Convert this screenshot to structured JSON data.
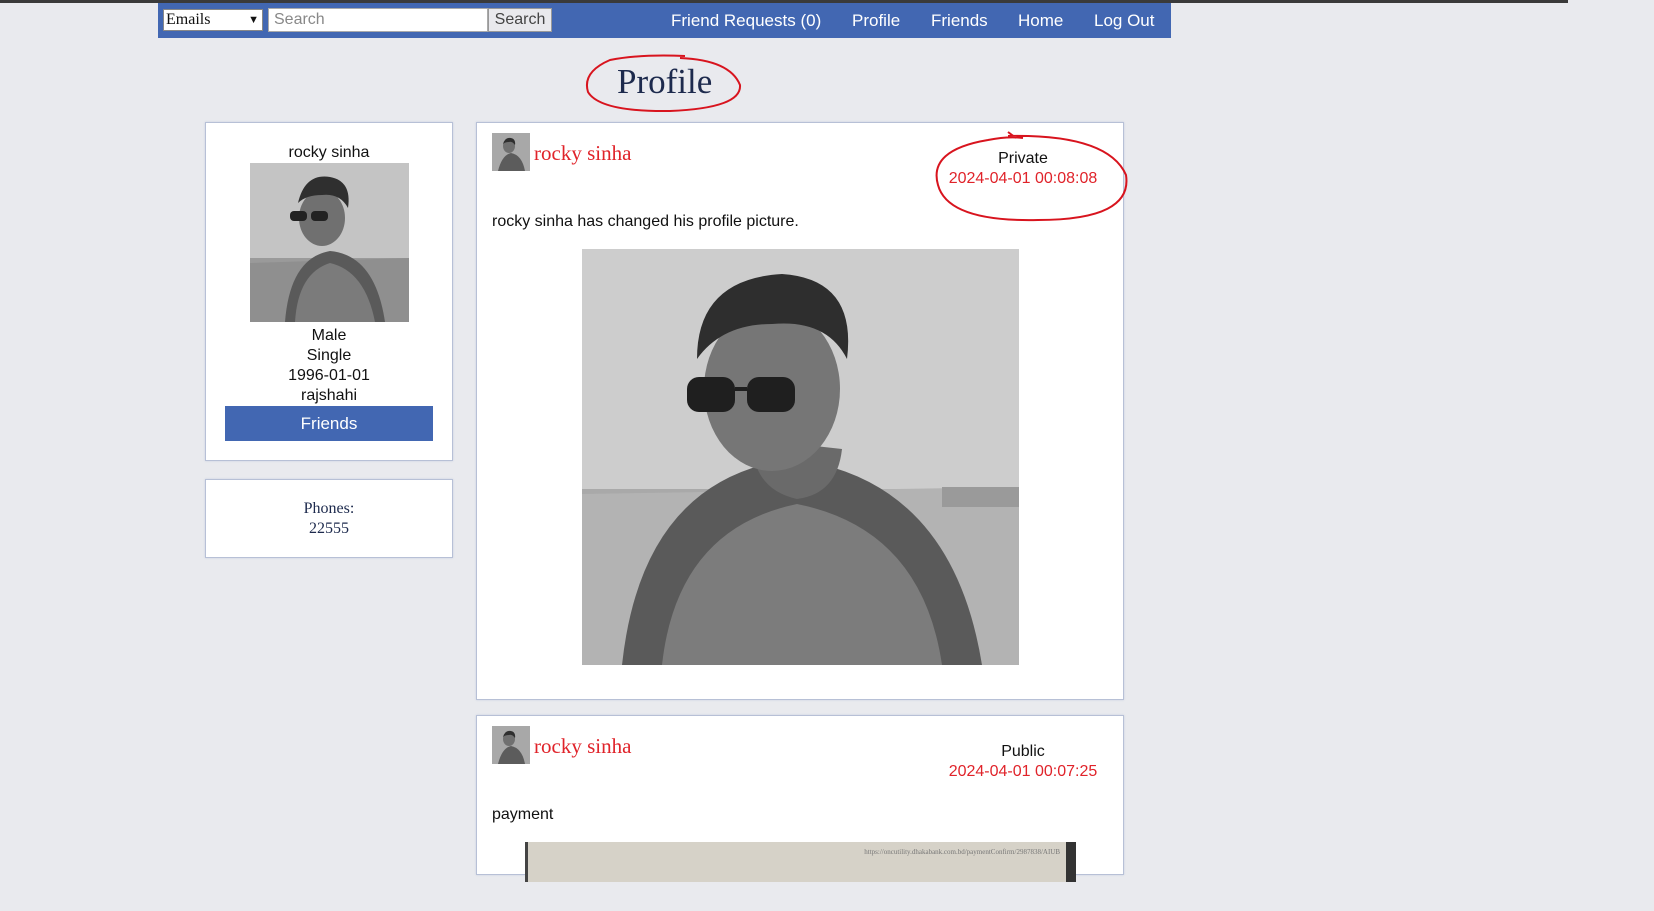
{
  "nav": {
    "select_value": "Emails",
    "search_placeholder": "Search",
    "search_button": "Search",
    "links": [
      "Friend Requests (0)",
      "Profile",
      "Friends",
      "Home",
      "Log Out"
    ]
  },
  "page": {
    "title": "Profile"
  },
  "profile": {
    "name": "rocky sinha",
    "gender": "Male",
    "relationship": "Single",
    "birthdate": "1996-01-01",
    "location": "rajshahi",
    "friends_button": "Friends"
  },
  "phones": {
    "label": "Phones:",
    "number": "22555"
  },
  "posts": [
    {
      "author": "rocky sinha",
      "privacy": "Private",
      "timestamp": "2024-04-01 00:08:08",
      "text": "rocky sinha has changed his profile picture."
    },
    {
      "author": "rocky sinha",
      "privacy": "Public",
      "timestamp": "2024-04-01 00:07:25",
      "text": "payment",
      "attachment_url": "https://oncutility.dhakabank.com.bd/paymentConfirm/2987838/AIUB"
    }
  ],
  "colors": {
    "nav": "#4267b2",
    "accent_red": "#e0232a",
    "annotation": "#d8141e"
  }
}
